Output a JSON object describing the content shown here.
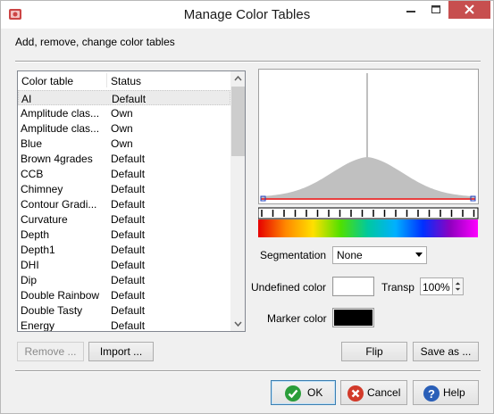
{
  "window": {
    "title": "Manage Color Tables"
  },
  "subtitle": "Add, remove, change color tables",
  "list": {
    "columns": [
      "Color table",
      "Status"
    ],
    "rows": [
      {
        "name": "AI",
        "status": "Default",
        "selected": true
      },
      {
        "name": "Amplitude clas...",
        "status": "Own"
      },
      {
        "name": "Amplitude clas...",
        "status": "Own"
      },
      {
        "name": "Blue",
        "status": "Own"
      },
      {
        "name": "Brown 4grades",
        "status": "Default"
      },
      {
        "name": "CCB",
        "status": "Default"
      },
      {
        "name": "Chimney",
        "status": "Default"
      },
      {
        "name": "Contour Gradi...",
        "status": "Default"
      },
      {
        "name": "Curvature",
        "status": "Default"
      },
      {
        "name": "Depth",
        "status": "Default"
      },
      {
        "name": "Depth1",
        "status": "Default"
      },
      {
        "name": "DHI",
        "status": "Default"
      },
      {
        "name": "Dip",
        "status": "Default"
      },
      {
        "name": "Double Rainbow",
        "status": "Default"
      },
      {
        "name": "Double Tasty",
        "status": "Default"
      },
      {
        "name": "Energy",
        "status": "Default"
      }
    ]
  },
  "segmentation": {
    "label": "Segmentation",
    "value": "None"
  },
  "undefined_color": {
    "label": "Undefined color",
    "color": "#ffffff"
  },
  "transparency": {
    "label": "Transp",
    "value": "100%"
  },
  "marker_color": {
    "label": "Marker color",
    "color": "#000000"
  },
  "buttons": {
    "remove": "Remove ...",
    "import": "Import ...",
    "flip": "Flip",
    "save_as": "Save as ...",
    "ok": "OK",
    "cancel": "Cancel",
    "help": "Help"
  },
  "colorbar": {
    "stops": [
      "#e60000",
      "#ff8800",
      "#ffe000",
      "#50e000",
      "#00c8a0",
      "#00b0ff",
      "#0030ff",
      "#9000c0",
      "#ff00ff"
    ]
  },
  "colors": {
    "close_button": "#c74f4f",
    "ok_icon": "#2a9d3a",
    "cancel_icon": "#d23a2a",
    "help_icon": "#2a5fb8"
  }
}
